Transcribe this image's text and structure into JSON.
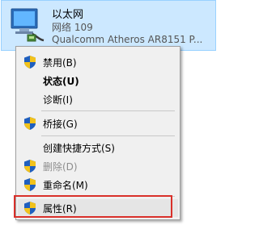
{
  "network": {
    "name": "以太网",
    "status": "网络  109",
    "device": "Qualcomm Atheros AR8151 P..."
  },
  "menu": {
    "items": [
      {
        "label": "禁用(B)",
        "icon": "uac-shield-icon"
      },
      {
        "label": "状态(U)"
      },
      {
        "label": "诊断(I)"
      },
      {
        "label": "桥接(G)",
        "icon": "uac-shield-icon"
      },
      {
        "label": "创建快捷方式(S)"
      },
      {
        "label": "删除(D)",
        "icon": "uac-shield-icon"
      },
      {
        "label": "重命名(M)",
        "icon": "uac-shield-icon"
      },
      {
        "label": "属性(R)",
        "icon": "uac-shield-icon"
      }
    ]
  },
  "colors": {
    "selection_bg": "#cce8ff",
    "menu_bg": "#f0f0f0",
    "highlight_border": "#d9302a",
    "shield_blue": "#1f5fbf",
    "shield_yellow": "#f2c21b"
  }
}
